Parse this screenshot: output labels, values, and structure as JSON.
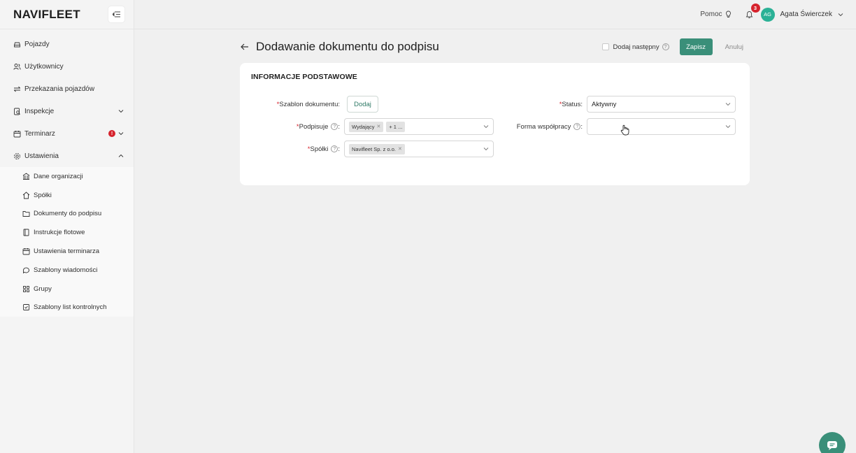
{
  "app": {
    "logo": "NAVIFLEET"
  },
  "topbar": {
    "help": "Pomoc",
    "notifications": "3",
    "avatar_initials": "AG",
    "user_name": "Agata Świerczek"
  },
  "sidebar": {
    "items": [
      {
        "label": "Pojazdy",
        "icon": "car-icon"
      },
      {
        "label": "Użytkownicy",
        "icon": "users-icon"
      },
      {
        "label": "Przekazania pojazdów",
        "icon": "transfer-icon"
      },
      {
        "label": "Inspekcje",
        "icon": "inspection-icon"
      },
      {
        "label": "Terminarz",
        "icon": "calendar-icon",
        "badge": "!"
      },
      {
        "label": "Ustawienia",
        "icon": "settings-icon"
      }
    ],
    "settings_sub": [
      {
        "label": "Dane organizacji",
        "icon": "building-icon"
      },
      {
        "label": "Spółki",
        "icon": "home-icon"
      },
      {
        "label": "Dokumenty do podpisu",
        "icon": "folder-icon"
      },
      {
        "label": "Instrukcje flotowe",
        "icon": "book-icon"
      },
      {
        "label": "Ustawienia terminarza",
        "icon": "calendar-icon"
      },
      {
        "label": "Szablony wiadomości",
        "icon": "message-icon"
      },
      {
        "label": "Grupy",
        "icon": "grid-icon"
      },
      {
        "label": "Szablony list kontrolnych",
        "icon": "checklist-icon"
      }
    ]
  },
  "page": {
    "title": "Dodawanie dokumentu do podpisu",
    "add_next": "Dodaj następny",
    "save": "Zapisz",
    "cancel": "Anuluj"
  },
  "form": {
    "section_title": "INFORMACJE PODSTAWOWE",
    "template_label": "Szablon dokumentu:",
    "template_button": "Dodaj",
    "signers_label": "Podpisuje",
    "signers_tags": [
      "Wydający",
      "+ 1 ..."
    ],
    "companies_label": "Spółki",
    "companies_tags": [
      "Navifleet Sp. z o.o."
    ],
    "status_label": "Status:",
    "status_value": "Aktywny",
    "cooperation_label": "Forma współpracy",
    "cooperation_value": ""
  }
}
